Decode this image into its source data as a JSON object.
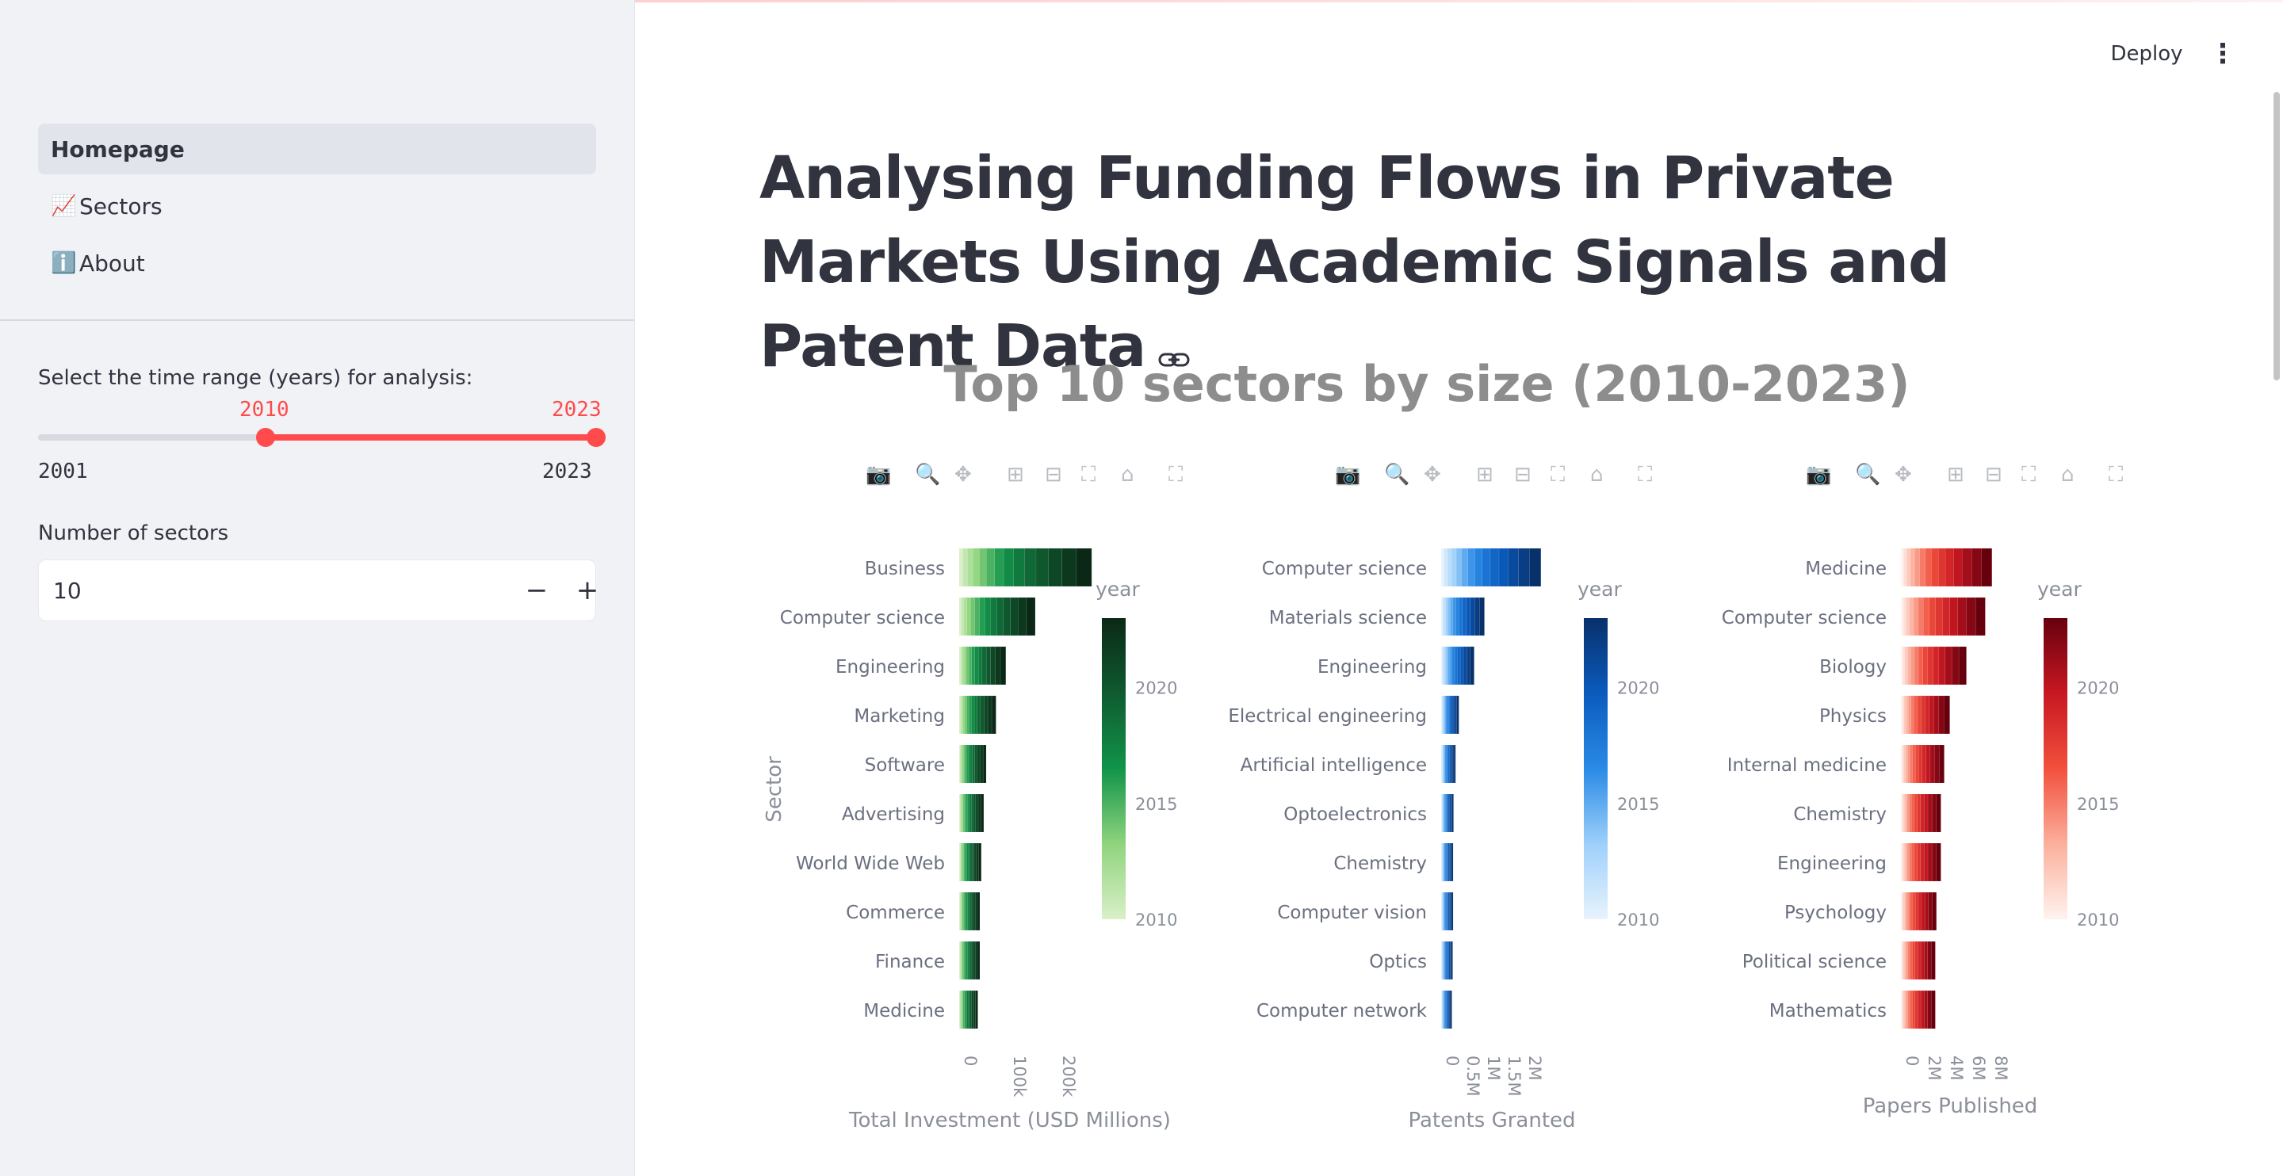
{
  "sidebar": {
    "nav": [
      {
        "label": "Homepage",
        "icon": "",
        "active": true
      },
      {
        "label": "Sectors",
        "icon": "📈",
        "active": false
      },
      {
        "label": "About",
        "icon": "ℹ️",
        "active": false
      }
    ],
    "time_range": {
      "label": "Select the time range (years) for analysis:",
      "selected_start": "2010",
      "selected_end": "2023",
      "min": "2001",
      "max": "2023"
    },
    "num_sectors": {
      "label": "Number of sectors",
      "value": "10",
      "decrement": "−",
      "increment": "+"
    }
  },
  "header": {
    "deploy_label": "Deploy",
    "menu_icon": "⋮"
  },
  "main": {
    "title": "Analysing Funding Flows in Private Markets Using Academic Signals and Patent Data",
    "chart_heading": "Top 10 sectors by size (2010-2023)"
  },
  "colors": {
    "accent": "#ff4b4b",
    "green_dark": "#0b3b1e",
    "green_light": "#c7e9b4",
    "blue_dark": "#08306b",
    "blue_light": "#deebf7",
    "red_dark": "#67000d",
    "red_light": "#fee0d2"
  },
  "chart_data": [
    {
      "type": "bar",
      "orientation": "horizontal",
      "stacked_by": "year",
      "categories": [
        "Business",
        "Computer science",
        "Engineering",
        "Marketing",
        "Software",
        "Advertising",
        "World Wide Web",
        "Commerce",
        "Finance",
        "Medicine"
      ],
      "values": [
        270000,
        155000,
        95000,
        75000,
        55000,
        50000,
        45000,
        42000,
        42000,
        38000
      ],
      "xlabel": "Total Investment (USD Millions)",
      "ylabel": "Sector",
      "x_ticks": [
        "0",
        "100k",
        "200k"
      ],
      "x_tick_values": [
        0,
        100000,
        200000
      ],
      "xlim": [
        0,
        420000
      ],
      "colorbar": {
        "title": "year",
        "ticks": [
          "2020",
          "2015",
          "2010"
        ],
        "range": [
          2010,
          2023
        ],
        "scale": "Greens"
      }
    },
    {
      "type": "bar",
      "orientation": "horizontal",
      "stacked_by": "year",
      "categories": [
        "Computer science",
        "Materials science",
        "Engineering",
        "Electrical engineering",
        "Artificial intelligence",
        "Optoelectronics",
        "Chemistry",
        "Computer vision",
        "Optics",
        "Computer network"
      ],
      "values": [
        2420000,
        1050000,
        800000,
        430000,
        350000,
        300000,
        290000,
        290000,
        280000,
        260000
      ],
      "xlabel": "Patents Granted",
      "ylabel": "",
      "x_ticks": [
        "0",
        "0.5M",
        "1M",
        "1.5M",
        "2M"
      ],
      "x_tick_values": [
        0,
        500000,
        1000000,
        1500000,
        2000000
      ],
      "xlim": [
        0,
        3500000
      ],
      "colorbar": {
        "title": "year",
        "ticks": [
          "2020",
          "2015",
          "2010"
        ],
        "range": [
          2010,
          2023
        ],
        "scale": "Blues"
      }
    },
    {
      "type": "bar",
      "orientation": "horizontal",
      "stacked_by": "year",
      "categories": [
        "Medicine",
        "Computer science",
        "Biology",
        "Physics",
        "Internal medicine",
        "Chemistry",
        "Engineering",
        "Psychology",
        "Political science",
        "Mathematics"
      ],
      "values": [
        8200000,
        7600000,
        5900000,
        4400000,
        3900000,
        3600000,
        3600000,
        3200000,
        3100000,
        3100000
      ],
      "xlabel": "Papers Published",
      "ylabel": "",
      "x_ticks": [
        "0",
        "2M",
        "4M",
        "6M",
        "8M"
      ],
      "x_tick_values": [
        0,
        2000000,
        4000000,
        6000000,
        8000000
      ],
      "xlim": [
        0,
        13000000
      ],
      "colorbar": {
        "title": "year",
        "ticks": [
          "2020",
          "2015",
          "2010"
        ],
        "range": [
          2010,
          2023
        ],
        "scale": "Reds"
      }
    }
  ]
}
